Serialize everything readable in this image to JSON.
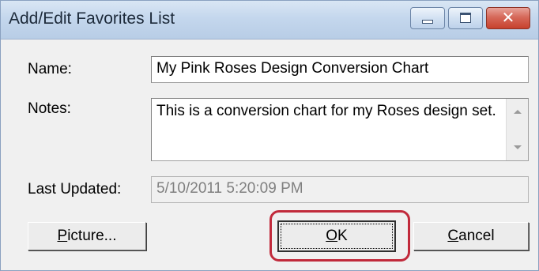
{
  "window": {
    "title": "Add/Edit Favorites List",
    "controls": {
      "minimize_icon": "minimize-icon",
      "maximize_icon": "maximize-icon",
      "close_icon": "close-icon",
      "close_glyph": "✕"
    }
  },
  "form": {
    "name_label": "Name:",
    "name_value": "My Pink Roses Design Conversion Chart",
    "notes_label": "Notes:",
    "notes_value": "This is a conversion chart for my Roses design set.",
    "last_updated_label": "Last Updated:",
    "last_updated_value": "5/10/2011 5:20:09 PM"
  },
  "buttons": {
    "picture": {
      "mnemonic": "P",
      "rest": "icture..."
    },
    "ok": {
      "mnemonic": "O",
      "rest": "K"
    },
    "cancel": {
      "mnemonic": "C",
      "rest": "ancel"
    }
  },
  "colors": {
    "highlight": "#c12a3b"
  }
}
